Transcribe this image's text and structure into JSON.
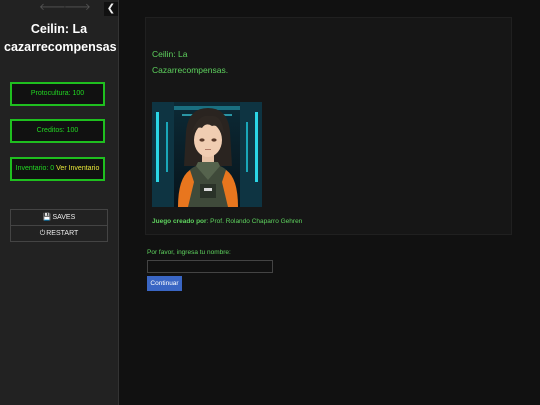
{
  "sidebar": {
    "back_glyph": "🡐",
    "forward_glyph": "🡒",
    "collapse_glyph": "❮",
    "title": "Ceilin: La cazarrecompensas",
    "stats": {
      "protocultura": "Protocultura: 100",
      "creditos": "Creditos: 100",
      "inventario": "Inventario: 0",
      "inventario_link": "Ver Inventario"
    },
    "menu": {
      "saves_label": "SAVES",
      "restart_label": "RESTART"
    }
  },
  "passage": {
    "intro_line1": "Ceilin: La",
    "intro_line2": "Cazarrecompensas.",
    "credits_label": "Juego creado por",
    "credits_value": ": Prof. Rolando Chaparro Gehren"
  },
  "form": {
    "name_label": "Por favor, ingresa tu nombre:",
    "name_value": "",
    "continue_label": "Continuar"
  },
  "colors": {
    "accent_green": "#22d622",
    "text_green": "#5ed35e",
    "link_yellow": "#e8e83a",
    "button_blue": "#3a66c4"
  },
  "icons": {
    "back": "back-arrow-icon",
    "forward": "forward-arrow-icon",
    "collapse": "chevron-left-icon",
    "saves": "floppy-disk-icon",
    "restart": "power-icon"
  }
}
